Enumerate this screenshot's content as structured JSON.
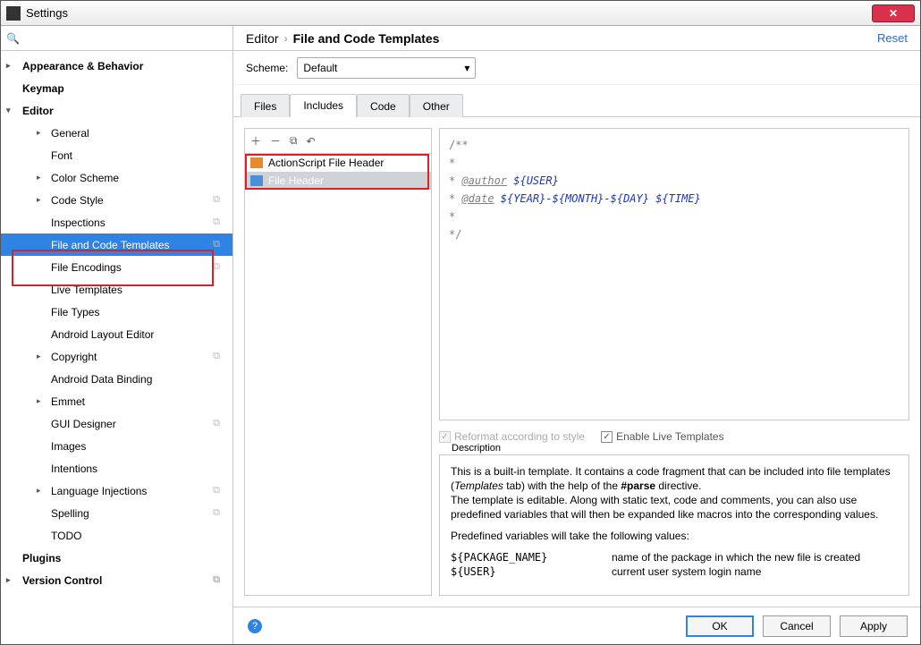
{
  "window": {
    "title": "Settings"
  },
  "sidebar": {
    "search_placeholder": "",
    "items": [
      {
        "label": "Appearance & Behavior",
        "level": 1,
        "arrow": "right",
        "bold": true
      },
      {
        "label": "Keymap",
        "level": 1,
        "bold": true
      },
      {
        "label": "Editor",
        "level": 1,
        "arrow": "down",
        "bold": true
      },
      {
        "label": "General",
        "level": 2,
        "arrow": "right"
      },
      {
        "label": "Font",
        "level": 2
      },
      {
        "label": "Color Scheme",
        "level": 2,
        "arrow": "right"
      },
      {
        "label": "Code Style",
        "level": 2,
        "arrow": "right",
        "copy": true
      },
      {
        "label": "Inspections",
        "level": 2,
        "copy": true
      },
      {
        "label": "File and Code Templates",
        "level": 2,
        "selected": true,
        "copy": true
      },
      {
        "label": "File Encodings",
        "level": 2,
        "copy": true
      },
      {
        "label": "Live Templates",
        "level": 2
      },
      {
        "label": "File Types",
        "level": 2
      },
      {
        "label": "Android Layout Editor",
        "level": 2
      },
      {
        "label": "Copyright",
        "level": 2,
        "arrow": "right",
        "copy": true
      },
      {
        "label": "Android Data Binding",
        "level": 2
      },
      {
        "label": "Emmet",
        "level": 2,
        "arrow": "right"
      },
      {
        "label": "GUI Designer",
        "level": 2,
        "copy": true
      },
      {
        "label": "Images",
        "level": 2
      },
      {
        "label": "Intentions",
        "level": 2
      },
      {
        "label": "Language Injections",
        "level": 2,
        "arrow": "right",
        "copy": true
      },
      {
        "label": "Spelling",
        "level": 2,
        "copy": true
      },
      {
        "label": "TODO",
        "level": 2
      },
      {
        "label": "Plugins",
        "level": 1,
        "bold": true
      },
      {
        "label": "Version Control",
        "level": 1,
        "arrow": "right",
        "bold": true,
        "copy": true
      }
    ]
  },
  "breadcrumb": {
    "root": "Editor",
    "leaf": "File and Code Templates"
  },
  "reset": "Reset",
  "scheme": {
    "label": "Scheme:",
    "value": "Default"
  },
  "tabs": [
    "Files",
    "Includes",
    "Code",
    "Other"
  ],
  "active_tab": 1,
  "includes": {
    "items": [
      {
        "label": "ActionScript File Header",
        "icon": "as"
      },
      {
        "label": "File Header",
        "icon": "fh",
        "selected": true
      }
    ]
  },
  "code": {
    "l1": "/**",
    "l2": " *",
    "l3_pre": " * ",
    "l3_tag": "@author",
    "l3_var": " ${USER}",
    "l4_pre": " * ",
    "l4_tag": "@date",
    "l4_var": " ${YEAR}-${MONTH}-${DAY} ${TIME}",
    "l5": " *",
    "l6": " */"
  },
  "options": {
    "reformat": "Reformat according to style",
    "live": "Enable Live Templates"
  },
  "description": {
    "label": "Description",
    "p1a": "This is a built-in template. It contains a code fragment that can be included into file templates (",
    "p1i": "Templates",
    "p1b": " tab) with the help of the ",
    "p1bold": "#parse",
    "p1c": " directive.",
    "p2": "The template is editable. Along with static text, code and comments, you can also use predefined variables that will then be expanded like macros into the corresponding values.",
    "p3": "Predefined variables will take the following values:",
    "vars": [
      {
        "name": "${PACKAGE_NAME}",
        "desc": "name of the package in which the new file is created"
      },
      {
        "name": "${USER}",
        "desc": "current user system login name"
      }
    ]
  },
  "buttons": {
    "ok": "OK",
    "cancel": "Cancel",
    "apply": "Apply"
  }
}
